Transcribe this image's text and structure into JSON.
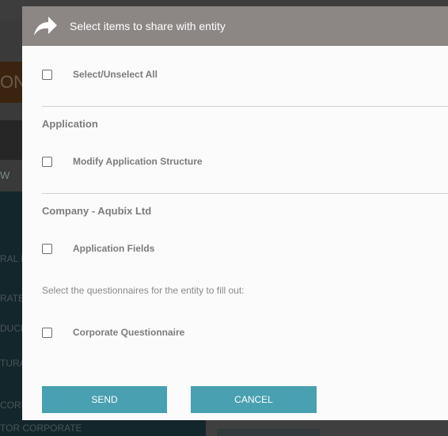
{
  "background": {
    "brand_fragment": "ON",
    "tab_fragment": "W",
    "sidebar_items": [
      "RAL PI",
      "RATE",
      "DUCE",
      "TURAI",
      "CORI",
      "TOR CORPORATE"
    ]
  },
  "modal": {
    "title": "Select items to share with entity",
    "header_icon": "share-arrow-icon",
    "select_all_label": "Select/Unselect All",
    "sections": [
      {
        "title": "Application",
        "items": [
          {
            "label": "Modify Application Structure",
            "checked": false
          }
        ]
      },
      {
        "title": "Company - Aqubix Ltd",
        "items": [
          {
            "label": "Application Fields",
            "checked": false
          }
        ]
      }
    ],
    "questionnaire_prompt": "Select the questionnaires for the entity to fill out:",
    "questionnaires": [
      {
        "label": "Corporate Questionnaire",
        "checked": false
      }
    ],
    "buttons": {
      "send": "SEND",
      "cancel": "CANCEL"
    }
  },
  "colors": {
    "header_bg": "#8c8785",
    "button_bg": "#48a0b0",
    "modal_bg": "#fbfbfb"
  }
}
